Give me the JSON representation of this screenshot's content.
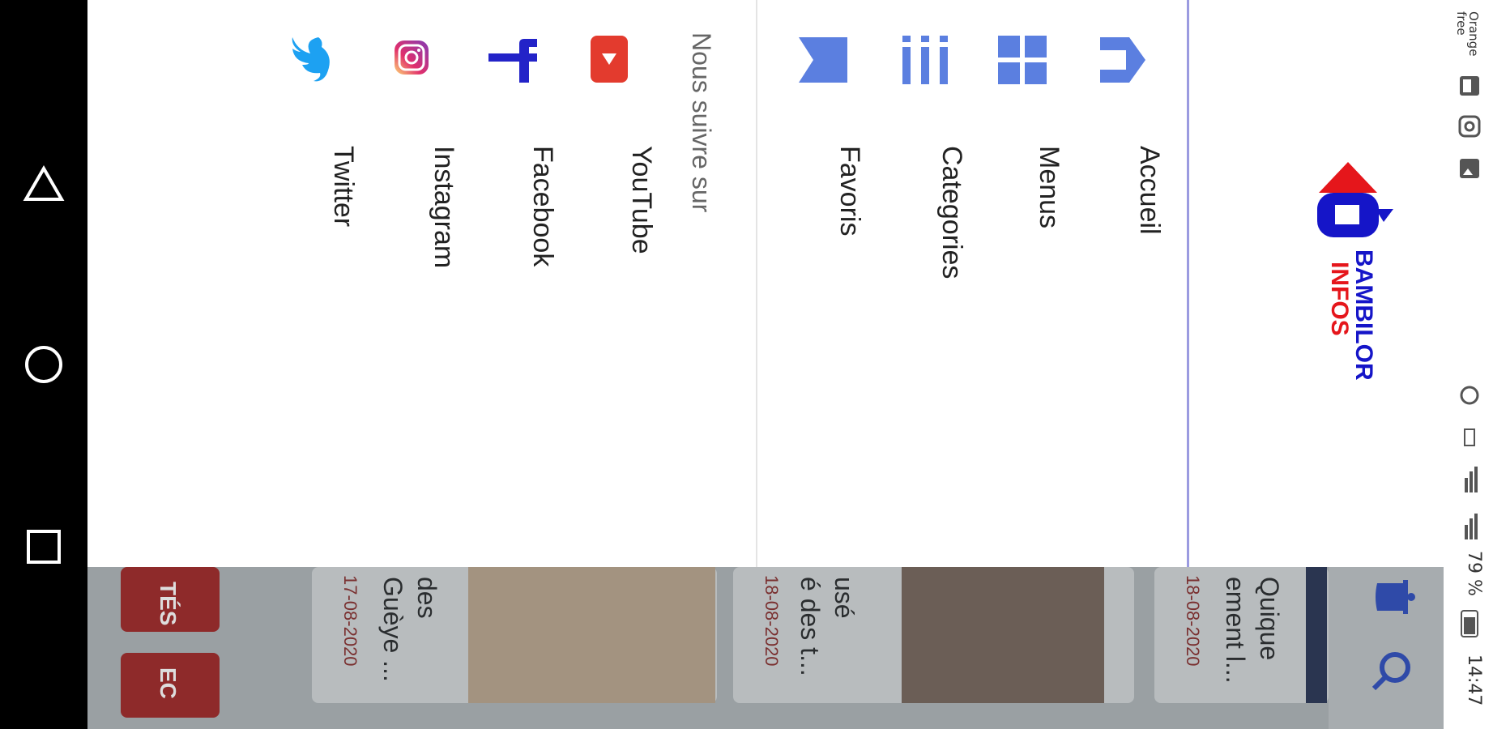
{
  "status_bar": {
    "carrier": "Orange free",
    "battery": "79 %",
    "time": "14:47"
  },
  "drawer": {
    "logo_text": [
      "BAMBILOR",
      "INFOS"
    ],
    "menu": [
      {
        "label": "Accueil",
        "icon": "home-icon"
      },
      {
        "label": "Menus",
        "icon": "grid-icon"
      },
      {
        "label": "Categories",
        "icon": "list-icon"
      },
      {
        "label": "Favoris",
        "icon": "bookmark-icon"
      }
    ],
    "follow_title": "Nous suivre sur",
    "social": [
      {
        "label": "YouTube",
        "icon": "youtube-icon"
      },
      {
        "label": "Facebook",
        "icon": "facebook-icon"
      },
      {
        "label": "Instagram",
        "icon": "instagram-icon"
      },
      {
        "label": "Twitter",
        "icon": "twitter-icon"
      }
    ]
  },
  "background": {
    "cards": [
      {
        "title": [
          "Quique",
          "ement l..."
        ],
        "date": "18-08-2020"
      },
      {
        "title": [
          "usé",
          "é des t..."
        ],
        "date": "18-08-2020"
      },
      {
        "title": [
          "des",
          "Guèye ..."
        ],
        "date": "17-08-2020"
      }
    ],
    "chips": [
      "TÉS",
      "EC"
    ]
  },
  "colors": {
    "accent_blue": "#5b7fe0",
    "logo_red": "#e5161b",
    "logo_blue": "#1515c8",
    "youtube_red": "#e33b2e",
    "twitter_blue": "#1da1f2",
    "facebook_blue": "#2323c8"
  }
}
